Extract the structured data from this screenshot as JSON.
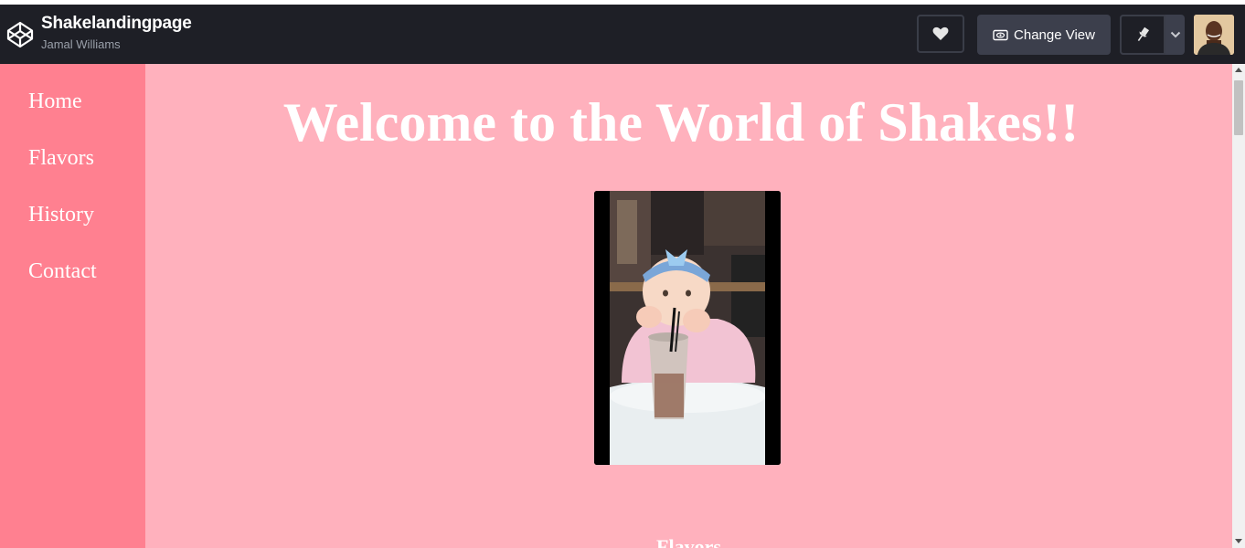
{
  "topbar": {
    "title": "Shakelandingpage",
    "author": "Jamal Williams",
    "change_view_label": "Change View"
  },
  "sidebar": {
    "items": [
      {
        "label": "Home"
      },
      {
        "label": "Flavors"
      },
      {
        "label": "History"
      },
      {
        "label": "Contact"
      }
    ]
  },
  "main": {
    "headline": "Welcome to the World of Shakes!!",
    "next_section_heading": "Flavors"
  },
  "colors": {
    "topbar": "#1e1f26",
    "sidebar": "#ff8090",
    "main_bg": "#ffb1bd",
    "text": "#ffffff"
  },
  "icons": [
    "codepen-logo-icon",
    "heart-icon",
    "eye-icon",
    "pin-icon",
    "chevron-down-icon"
  ]
}
